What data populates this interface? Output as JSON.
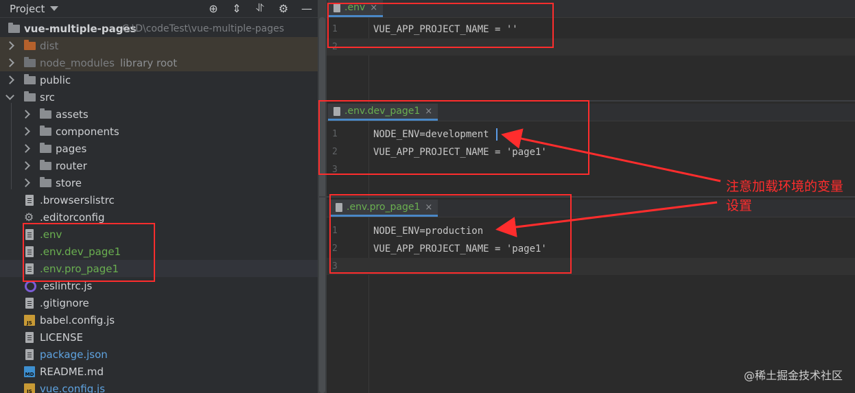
{
  "project_panel": {
    "title": "Project",
    "root": {
      "name": "vue-multiple-pages",
      "path": "C:\\D\\codeTest\\vue-multiple-pages"
    },
    "items": [
      {
        "label": "dist",
        "kind": "folder-excluded"
      },
      {
        "label": "node_modules",
        "hint": "library root",
        "kind": "folder-excluded"
      },
      {
        "label": "public",
        "kind": "folder"
      },
      {
        "label": "src",
        "kind": "folder-open"
      },
      {
        "label": "assets",
        "kind": "subfolder"
      },
      {
        "label": "components",
        "kind": "subfolder"
      },
      {
        "label": "pages",
        "kind": "subfolder"
      },
      {
        "label": "router",
        "kind": "subfolder"
      },
      {
        "label": "store",
        "kind": "subfolder"
      },
      {
        "label": ".browserslistrc",
        "kind": "file"
      },
      {
        "label": ".editorconfig",
        "kind": "gear-file"
      },
      {
        "label": ".env",
        "kind": "env-file"
      },
      {
        "label": ".env.dev_page1",
        "kind": "env-file"
      },
      {
        "label": ".env.pro_page1",
        "kind": "env-file"
      },
      {
        "label": ".eslintrc.js",
        "kind": "eslint-file"
      },
      {
        "label": ".gitignore",
        "kind": "git-file"
      },
      {
        "label": "babel.config.js",
        "kind": "js-file"
      },
      {
        "label": "LICENSE",
        "kind": "file"
      },
      {
        "label": "package.json",
        "kind": "json-file"
      },
      {
        "label": "README.md",
        "kind": "md-file"
      },
      {
        "label": "vue.config.js",
        "kind": "js-file"
      }
    ]
  },
  "editors": [
    {
      "tab": ".env",
      "lines": [
        "VUE_APP_PROJECT_NAME = ''",
        ""
      ],
      "line_numbers": [
        "1",
        "2"
      ]
    },
    {
      "tab": ".env.dev_page1",
      "lines": [
        "NODE_ENV=development",
        "VUE_APP_PROJECT_NAME = 'page1'",
        ""
      ],
      "line_numbers": [
        "1",
        "2",
        "3"
      ]
    },
    {
      "tab": ".env.pro_page1",
      "lines": [
        "NODE_ENV=production",
        "VUE_APP_PROJECT_NAME = 'page1'",
        ""
      ],
      "line_numbers": [
        "1",
        "2",
        "3"
      ]
    }
  ],
  "tab_close_glyph": "×",
  "annotation": {
    "text": "注意加载环境的变量设置",
    "color": "#ff2d2d"
  },
  "watermark": "@稀土掘金技术社区"
}
